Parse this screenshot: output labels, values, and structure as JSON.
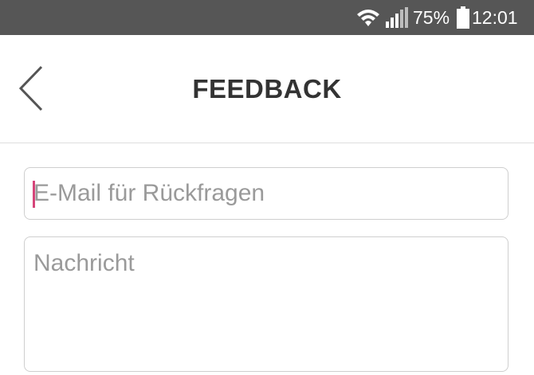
{
  "status_bar": {
    "battery_percent": "75%",
    "time": "12:01",
    "icons": [
      "wifi-icon",
      "signal-icon",
      "battery-icon"
    ]
  },
  "header": {
    "title": "FEEDBACK",
    "back_icon": "chevron-left-icon"
  },
  "form": {
    "email_placeholder": "E-Mail für Rückfragen",
    "email_value": "",
    "message_placeholder": "Nachricht",
    "message_value": ""
  },
  "colors": {
    "status_bar_bg": "#565656",
    "title_text": "#333333",
    "placeholder_text": "#9a9a9a",
    "cursor_accent": "#d6457a",
    "field_border": "#cfcfcf"
  }
}
